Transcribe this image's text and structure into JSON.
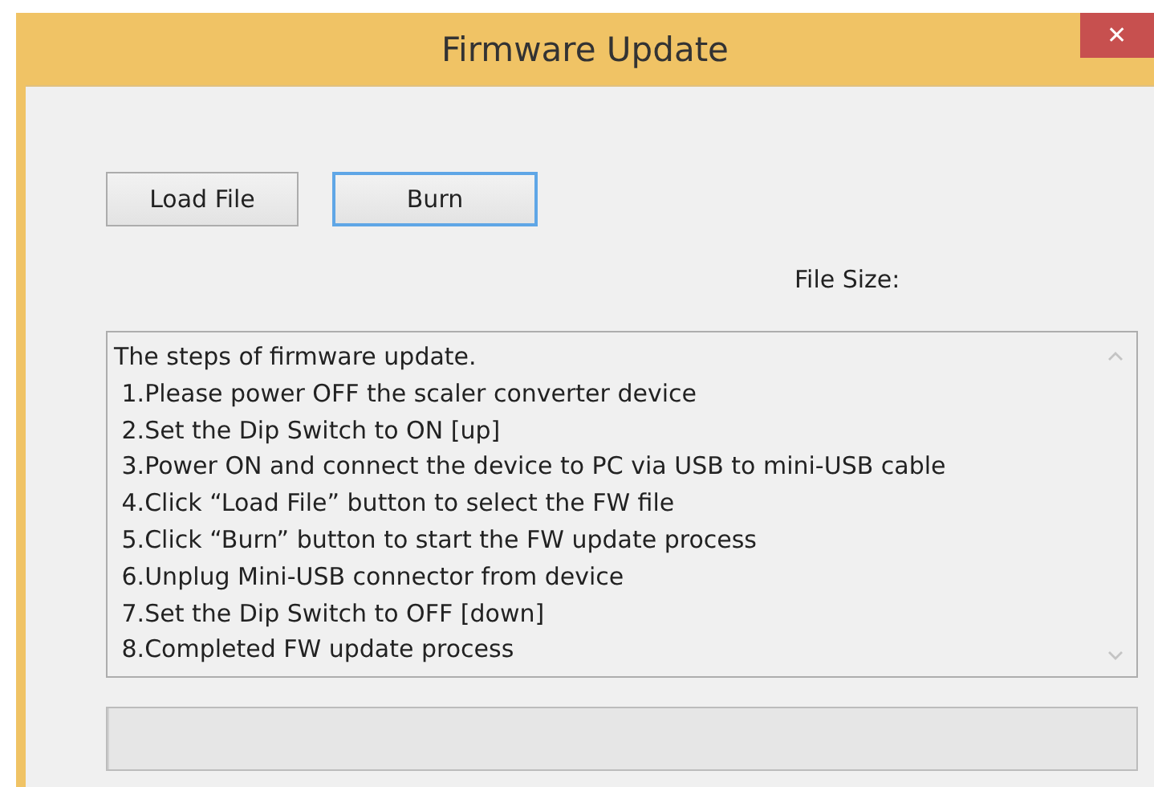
{
  "window": {
    "title": "Firmware Update",
    "close": "✕"
  },
  "buttons": [
    {
      "label": "Load File",
      "focused": false
    },
    {
      "label": "Burn",
      "focused": true
    }
  ],
  "file_size_label": "File Size:",
  "steps_text": [
    "The steps of firmware update.",
    " 1.Please power OFF the scaler converter device",
    " 2.Set the Dip Switch to ON [up]",
    " 3.Power ON and connect the device to PC via USB to mini-USB cable",
    " 4.Click “Load File” button to select the FW file",
    " 5.Click “Burn” button to start the FW update process",
    " 6.Unplug Mini-USB connector from device",
    " 7.Set the Dip Switch to OFF [down]",
    " 8.Completed FW update process"
  ],
  "progress": {
    "level": 0
  }
}
